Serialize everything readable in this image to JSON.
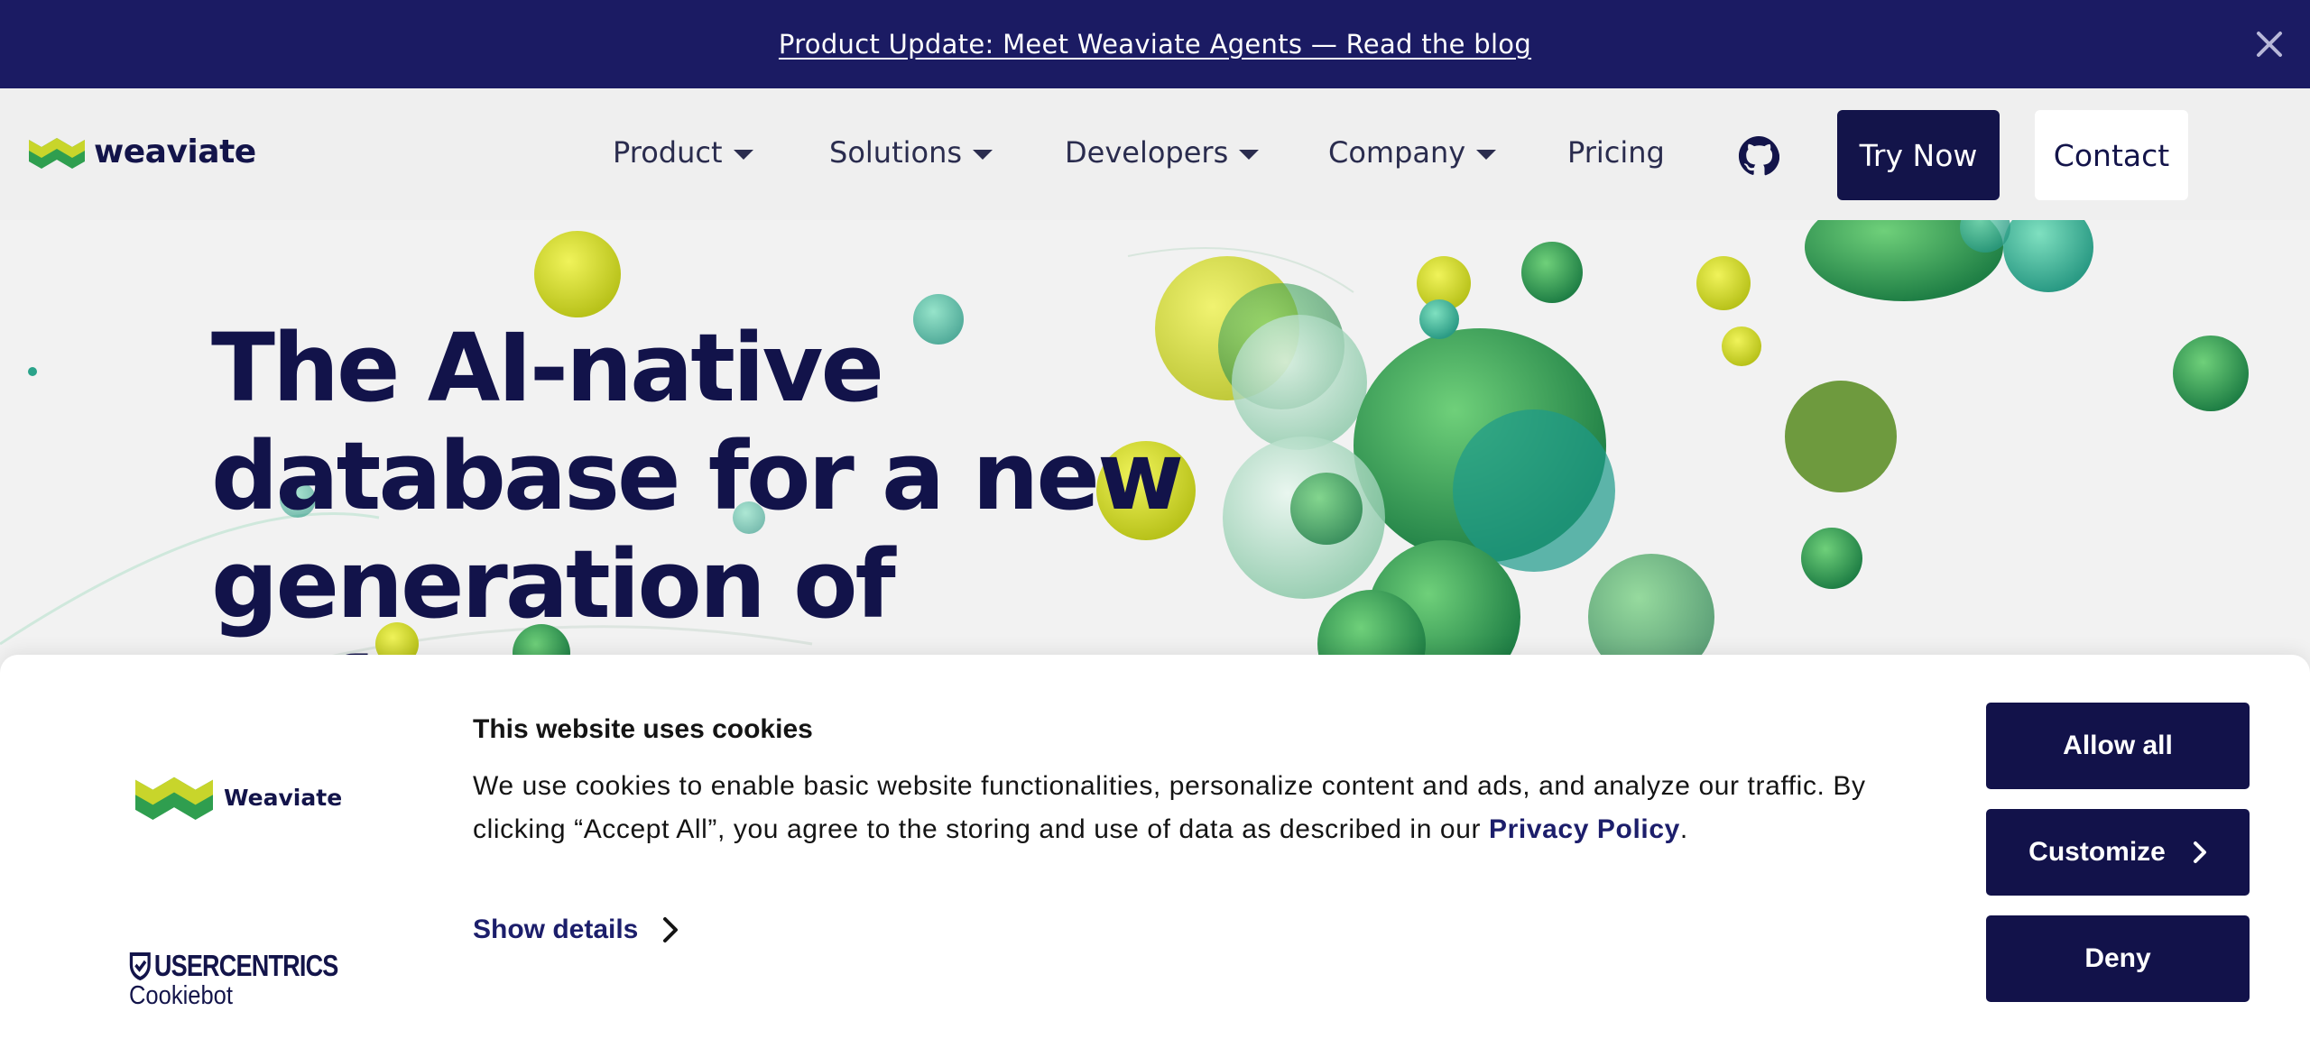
{
  "announcement": {
    "text": "Product Update: Meet Weaviate Agents — Read the blog",
    "close_icon": "close-icon"
  },
  "nav": {
    "brand": "weaviate",
    "items": [
      {
        "label": "Product",
        "has_dropdown": true
      },
      {
        "label": "Solutions",
        "has_dropdown": true
      },
      {
        "label": "Developers",
        "has_dropdown": true
      },
      {
        "label": "Company",
        "has_dropdown": true
      },
      {
        "label": "Pricing",
        "has_dropdown": false
      }
    ],
    "github_icon": "github-icon",
    "try_now": "Try Now",
    "contact": "Contact"
  },
  "hero": {
    "title": "The AI-native database for a new generation of software"
  },
  "cookie": {
    "logo_text": "Weaviate",
    "title": "This website uses cookies",
    "text": "We use cookies to enable basic website functionalities, personalize content and ads, and analyze our traffic. By clicking “Accept All”, you agree to the storing and use of data as described in our ",
    "privacy_link": "Privacy Policy",
    "text_end": ".",
    "show_details": "Show details",
    "buttons": {
      "allow_all": "Allow all",
      "customize": "Customize",
      "deny": "Deny"
    },
    "provider": "USERCENTRICS",
    "provider_sub": "Cookiebot"
  },
  "colors": {
    "brand_navy": "#13144a",
    "announce_bg": "#1b1b63",
    "accent_green": "#2e9e52",
    "accent_yellow": "#c9d62a"
  }
}
